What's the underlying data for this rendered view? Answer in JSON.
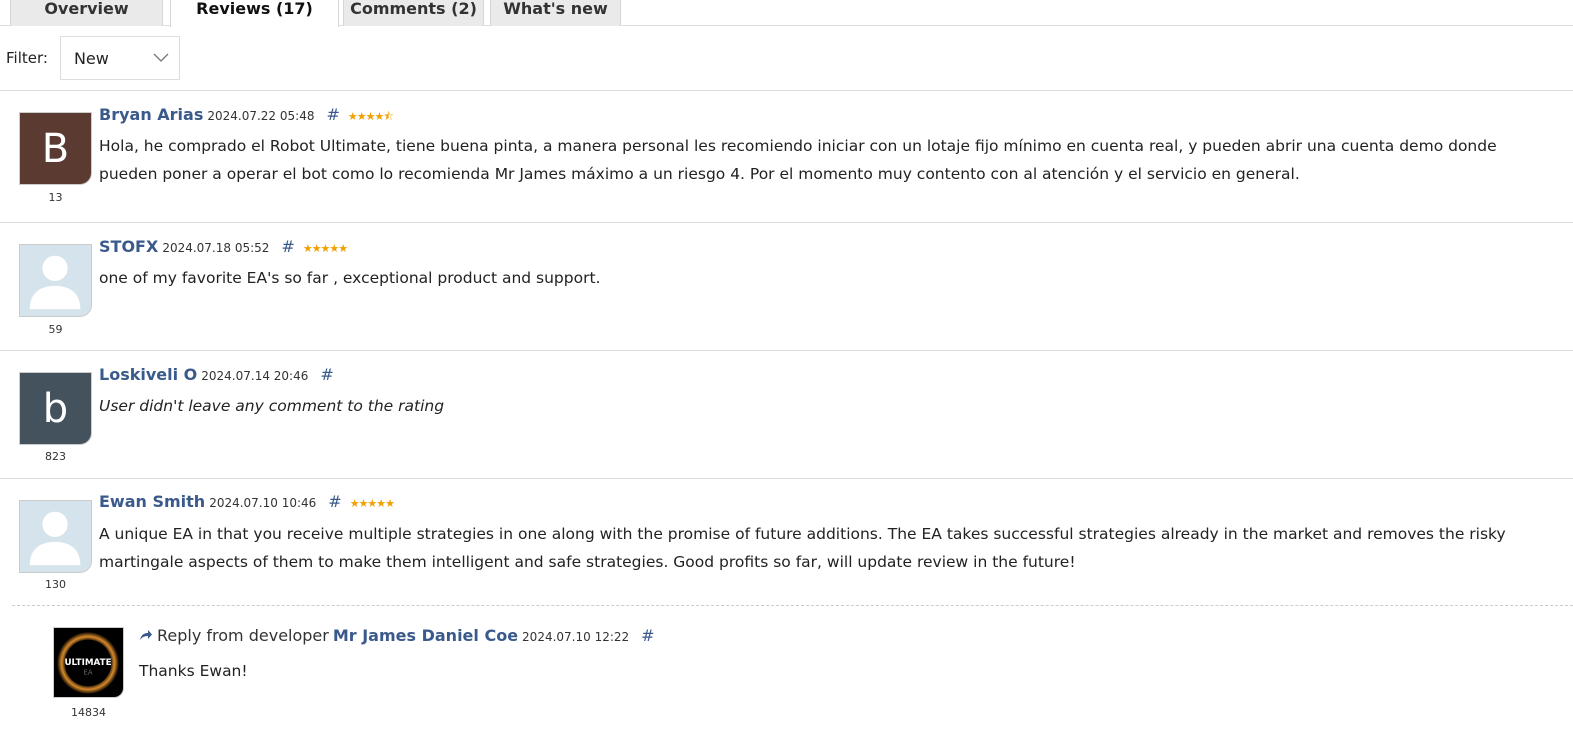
{
  "tabs": [
    {
      "label": "Overview"
    },
    {
      "label": "Reviews (17)",
      "active": true
    },
    {
      "label": "Comments (2)"
    },
    {
      "label": "What's new"
    }
  ],
  "filter": {
    "label": "Filter:",
    "value": "New"
  },
  "reviews": [
    {
      "name": "Bryan Arias",
      "date": "2024.07.22 05:48",
      "hash": "#",
      "rating": 4.5,
      "stars": "★★★★⯪",
      "avatar_letter": "B",
      "avatar_color": "#5b3a32",
      "count": "13",
      "text": "Hola, he comprado el Robot Ultimate, tiene buena pinta, a manera personal les recomiendo iniciar con un lotaje fijo mínimo en cuenta real, y pueden abrir una cuenta demo donde pueden poner a operar el bot como lo recomienda Mr James máximo a un riesgo 4. Por el momento muy contento con al atención y el servicio en general."
    },
    {
      "name": "STOFX",
      "date": "2024.07.18 05:52",
      "hash": "#",
      "rating": 5,
      "stars": "★★★★★",
      "avatar_icon": "default-user-icon",
      "count": "59",
      "text": "one of my favorite EA's so far , exceptional product and support."
    },
    {
      "name": "Loskiveli O",
      "date": "2024.07.14 20:46",
      "hash": "#",
      "avatar_letter": "b",
      "avatar_color": "#44525e",
      "count": "823",
      "text": "User didn't leave any comment to the rating"
    },
    {
      "name": "Ewan Smith",
      "date": "2024.07.10 10:46",
      "hash": "#",
      "rating": 5,
      "stars": "★★★★★",
      "avatar_icon": "default-user-icon",
      "count": "130",
      "text": "A unique EA in that you receive multiple strategies in one along with the promise of future additions. The EA takes successful strategies already in the market and removes the risky martingale aspects of them to make them intelligent and safe strategies. Good profits so far, will update review in the future!"
    }
  ],
  "reply": {
    "prefix": "Reply from developer",
    "name": "Mr James Daniel Coe",
    "date": "2024.07.10 12:22",
    "hash": "#",
    "count": "14834",
    "text": "Thanks Ewan!",
    "logo_text": "ULTIMATE EA"
  },
  "colors": {
    "link": "#3a5a8c",
    "star": "#f0a000"
  }
}
